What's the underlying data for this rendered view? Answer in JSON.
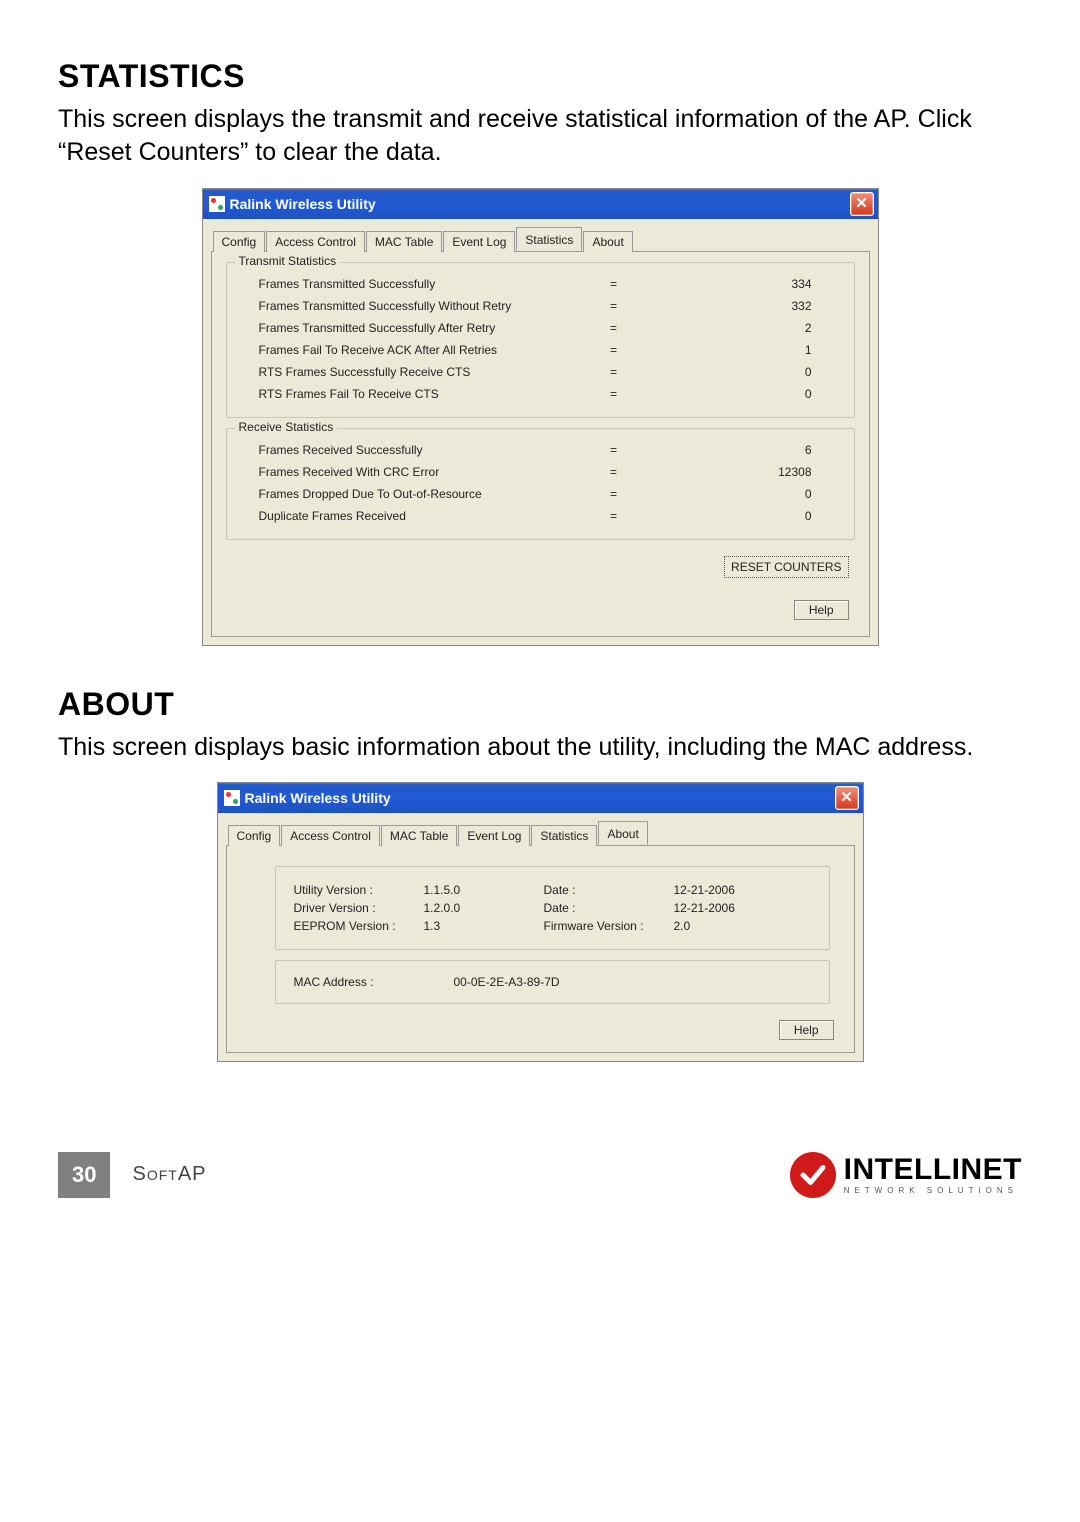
{
  "headings": {
    "statistics": "STATISTICS",
    "about": "ABOUT"
  },
  "paragraphs": {
    "statistics": "This screen displays the transmit and receive statistical information of the AP. Click “Reset Counters” to clear the data.",
    "about": "This screen displays basic information about the utility, including the MAC address."
  },
  "window": {
    "title": "Ralink Wireless Utility",
    "close_glyph": "✕",
    "tabs": {
      "config": "Config",
      "access_control": "Access Control",
      "mac_table": "MAC Table",
      "event_log": "Event Log",
      "statistics": "Statistics",
      "about": "About"
    }
  },
  "statistics": {
    "transmit_legend": "Transmit Statistics",
    "receive_legend": "Receive Statistics",
    "eq": "=",
    "tx": [
      {
        "label": "Frames Transmitted Successfully",
        "value": "334"
      },
      {
        "label": "Frames Transmitted Successfully Without Retry",
        "value": "332"
      },
      {
        "label": "Frames Transmitted Successfully After Retry",
        "value": "2"
      },
      {
        "label": "Frames Fail To Receive ACK After All Retries",
        "value": "1"
      },
      {
        "label": "RTS Frames Successfully Receive CTS",
        "value": "0"
      },
      {
        "label": "RTS Frames Fail To Receive CTS",
        "value": "0"
      }
    ],
    "rx": [
      {
        "label": "Frames Received Successfully",
        "value": "6"
      },
      {
        "label": "Frames Received With CRC Error",
        "value": "12308"
      },
      {
        "label": "Frames Dropped Due To Out-of-Resource",
        "value": "0"
      },
      {
        "label": "Duplicate Frames Received",
        "value": "0"
      }
    ],
    "reset_button": "RESET COUNTERS",
    "help_button": "Help"
  },
  "about": {
    "rows": [
      {
        "l1": "Utility Version :",
        "v1": "1.1.5.0",
        "l2": "Date :",
        "v2": "12-21-2006"
      },
      {
        "l1": "Driver Version :",
        "v1": "1.2.0.0",
        "l2": "Date :",
        "v2": "12-21-2006"
      },
      {
        "l1": "EEPROM Version :",
        "v1": "1.3",
        "l2": "Firmware Version :",
        "v2": "2.0"
      }
    ],
    "mac_label": "MAC Address :",
    "mac_value": "00-0E-2E-A3-89-7D",
    "help_button": "Help"
  },
  "footer": {
    "page_number": "30",
    "section": "SoftAP",
    "brand_name": "INTELLINET",
    "brand_sub": "NETWORK SOLUTIONS"
  }
}
